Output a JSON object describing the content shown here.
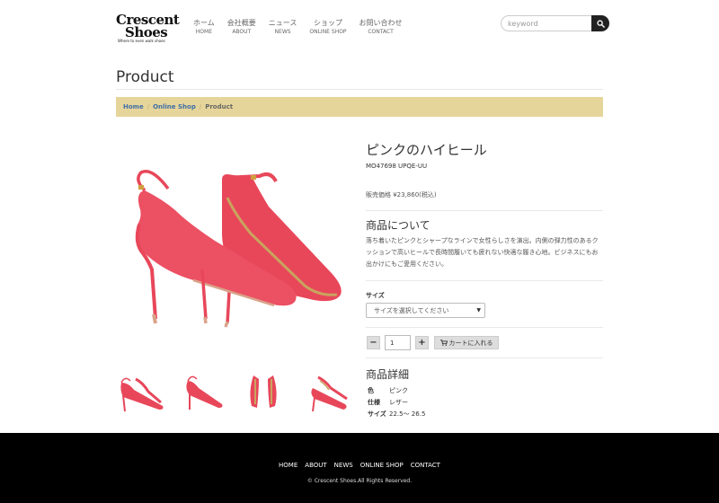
{
  "header": {
    "logo": {
      "line1": "Crescent",
      "line2": "Shoes",
      "tagline": "Where to even walk shoes"
    },
    "nav": [
      {
        "jp": "ホーム",
        "en": "HOME"
      },
      {
        "jp": "会社概要",
        "en": "ABOUT"
      },
      {
        "jp": "ニュース",
        "en": "NEWS"
      },
      {
        "jp": "ショップ",
        "en": "ONLINE SHOP"
      },
      {
        "jp": "お問い合わせ",
        "en": "CONTACT"
      }
    ],
    "search": {
      "placeholder": "keyword",
      "icon": "search-icon"
    }
  },
  "page": {
    "title": "Product"
  },
  "breadcrumb": {
    "home": "Home",
    "shop": "Online Shop",
    "current": "Product"
  },
  "product": {
    "name": "ピンクのハイヒール",
    "sku": "MO47698 UPQE-UU",
    "price": "販売価格 ¥23,860(税込)",
    "about_title": "商品について",
    "about_text": "落ち着いたピンクとシャープなラインで女性らしさを演出。内側の弾力性のあるクッションで高いヒールで長時間履いても疲れない快適な履き心地。ビジネスにもお出かけにもご愛用ください。",
    "size_label": "サイズ",
    "size_select": "サイズを選択してください",
    "quantity": "1",
    "qty_minus": "−",
    "qty_plus": "+",
    "cart_label": "カートに入れる",
    "detail_title": "商品詳細",
    "details": [
      {
        "key": "色",
        "value": "ピンク"
      },
      {
        "key": "仕様",
        "value": "レザー"
      },
      {
        "key": "サイズ",
        "value": "22.5〜 26.5"
      }
    ],
    "colors": {
      "shoe": "#e8475a",
      "sole": "#d9a38a",
      "accent": "#e6d59a"
    }
  },
  "footer": {
    "links": [
      "HOME",
      "ABOUT",
      "NEWS",
      "ONLINE SHOP",
      "CONTACT"
    ],
    "copyright": "© Crescent Shoes.All Rights Reserved."
  }
}
